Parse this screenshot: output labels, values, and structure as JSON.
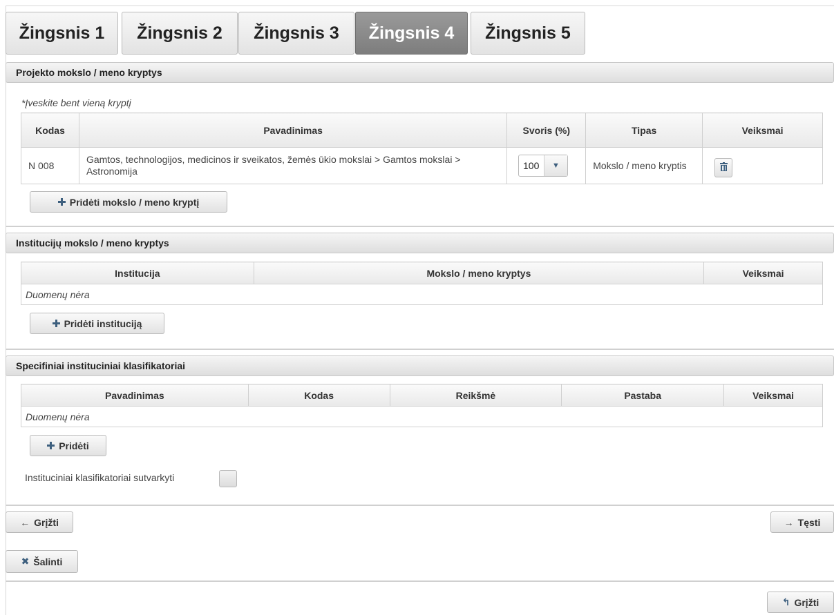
{
  "tabs": [
    "Žingsnis 1",
    "Žingsnis 2",
    "Žingsnis 3",
    "Žingsnis 4",
    "Žingsnis 5"
  ],
  "active_tab": "Žingsnis 4",
  "section1": {
    "title": "Projekto mokslo / meno kryptys",
    "note": "*Įveskite bent vieną kryptį",
    "columns": [
      "Kodas",
      "Pavadinimas",
      "Svoris (%)",
      "Tipas",
      "Veiksmai"
    ],
    "row": {
      "kodas": "N 008",
      "pavadinimas": "Gamtos, technologijos, medicinos ir sveikatos, žemės ūkio mokslai > Gamtos mokslai > Astronomija",
      "svoris": "100",
      "tipas": "Mokslo / meno kryptis"
    },
    "add_button": "Pridėti mokslo / meno kryptį"
  },
  "section2": {
    "title": "Institucijų mokslo / meno kryptys",
    "columns": [
      "Institucija",
      "Mokslo / meno kryptys",
      "Veiksmai"
    ],
    "empty": "Duomenų nėra",
    "add_button": "Pridėti instituciją"
  },
  "section3": {
    "title": "Specifiniai instituciniai klasifikatoriai",
    "columns": [
      "Pavadinimas",
      "Kodas",
      "Reikšmė",
      "Pastaba",
      "Veiksmai"
    ],
    "empty": "Duomenų nėra",
    "add_button": "Pridėti",
    "checkbox_label": "Instituciniai klasifikatoriai sutvarkyti"
  },
  "nav": {
    "back": "Grįžti",
    "next": "Tęsti",
    "delete": "Šalinti",
    "back_bottom": "Grįžti"
  },
  "icons": {
    "arrow_left": "←",
    "arrow_right": "→",
    "close": "✖",
    "return": "↰",
    "trash": "🗑",
    "caret": "▼"
  }
}
